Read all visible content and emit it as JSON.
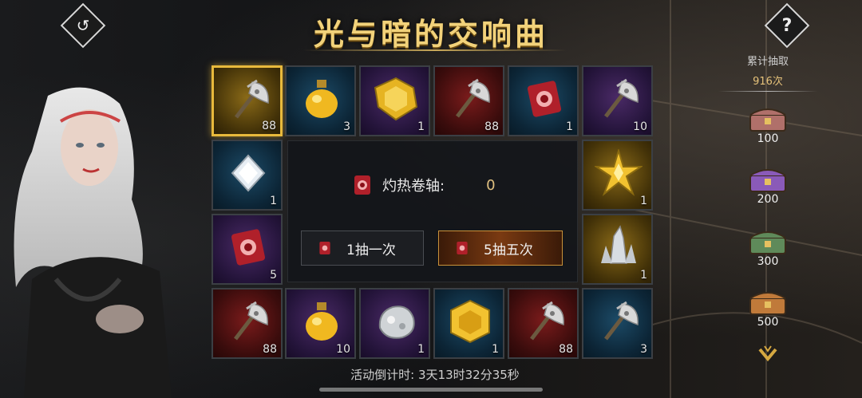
{
  "title": "光与暗的交响曲",
  "back_icon": "back-arrow-icon",
  "help_label": "?",
  "side_panel": {
    "title": "累计抽取",
    "count": "916次",
    "milestones": [
      {
        "label": "100",
        "color": "#b0706a"
      },
      {
        "label": "200",
        "color": "#8a5ab8"
      },
      {
        "label": "300",
        "color": "#5f8a5a"
      },
      {
        "label": "500",
        "color": "#c07a3a"
      }
    ]
  },
  "slots": [
    {
      "icon": "axe-icon",
      "qty": "88",
      "rarity": "gold",
      "selected": true
    },
    {
      "icon": "potion-icon",
      "qty": "3",
      "rarity": "blue"
    },
    {
      "icon": "gold-gem-icon",
      "qty": "1",
      "rarity": "purple"
    },
    {
      "icon": "axe-icon",
      "qty": "88",
      "rarity": "red"
    },
    {
      "icon": "scroll-icon",
      "qty": "1",
      "rarity": "blue"
    },
    {
      "icon": "axe-icon",
      "qty": "10",
      "rarity": "purple"
    },
    {
      "icon": "diamond-icon",
      "qty": "1",
      "rarity": "blue"
    },
    {
      "icon": "gold-star-icon",
      "qty": "1",
      "rarity": "gold"
    },
    {
      "icon": "scroll-icon",
      "qty": "5",
      "rarity": "purple"
    },
    {
      "icon": "crystal-icon",
      "qty": "1",
      "rarity": "gold"
    },
    {
      "icon": "axe-icon",
      "qty": "88",
      "rarity": "red"
    },
    {
      "icon": "potion-icon",
      "qty": "10",
      "rarity": "purple"
    },
    {
      "icon": "silver-ore-icon",
      "qty": "1",
      "rarity": "purple"
    },
    {
      "icon": "gold-hex-icon",
      "qty": "1",
      "rarity": "blue"
    },
    {
      "icon": "axe-icon",
      "qty": "88",
      "rarity": "red"
    },
    {
      "icon": "axe-icon",
      "qty": "3",
      "rarity": "blue"
    }
  ],
  "center": {
    "scroll_label": "灼热卷轴:",
    "scroll_count": "0",
    "draw_one": "1抽一次",
    "draw_five": "5抽五次"
  },
  "timer": "活动倒计时: 3天13时32分35秒"
}
